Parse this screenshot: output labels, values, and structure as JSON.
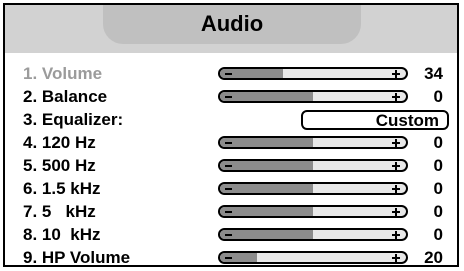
{
  "menu": {
    "title": "Audio"
  },
  "rows": [
    {
      "label": "1. Volume",
      "type": "slider",
      "value": "34",
      "level": 0.34,
      "selected": false,
      "dim": true
    },
    {
      "label": "2. Balance",
      "type": "slider",
      "value": "0",
      "level": 0.5
    },
    {
      "label": "3. Equalizer:",
      "type": "select",
      "value": "Custom"
    },
    {
      "label": "4. 120 Hz",
      "type": "slider",
      "value": "0",
      "level": 0.5
    },
    {
      "label": "5. 500 Hz",
      "type": "slider",
      "value": "0",
      "level": 0.5
    },
    {
      "label": "6. 1.5 kHz",
      "type": "slider",
      "value": "0",
      "level": 0.5
    },
    {
      "label": "7. 5   kHz",
      "type": "slider",
      "value": "0",
      "level": 0.5
    },
    {
      "label": "8. 10  kHz",
      "type": "slider",
      "value": "0",
      "level": 0.5
    },
    {
      "label": "9. HP Volume",
      "type": "slider",
      "value": "20",
      "level": 0.2
    }
  ],
  "colors": {
    "header_band": "#d2d2d2",
    "title_tab": "#c0c0c0",
    "slider_fill": "#8c8c8c",
    "dim_text": "#9b9b9b"
  }
}
